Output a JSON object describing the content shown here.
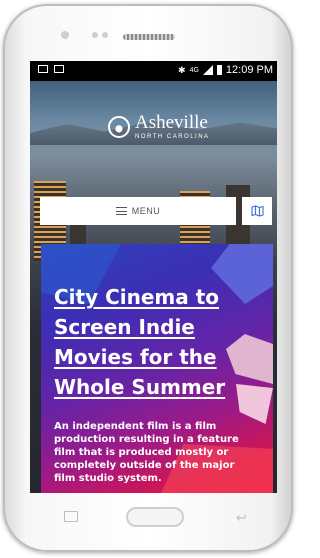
{
  "status_bar": {
    "time": "12:09 PM",
    "network": "4G"
  },
  "site": {
    "logo_name": "Asheville",
    "logo_subtitle": "NORTH CAROLINA"
  },
  "nav": {
    "menu_label": "MENU",
    "map_icon": "map-icon"
  },
  "article": {
    "title": "City Cinema to Screen Indie Movies for the Whole Summer",
    "description": "An independent film is a film production resulting in a feature film that is produced mostly or completely outside of the major film studio system."
  },
  "colors": {
    "card_top": "#2f43b8",
    "card_bottom": "#e31244"
  }
}
